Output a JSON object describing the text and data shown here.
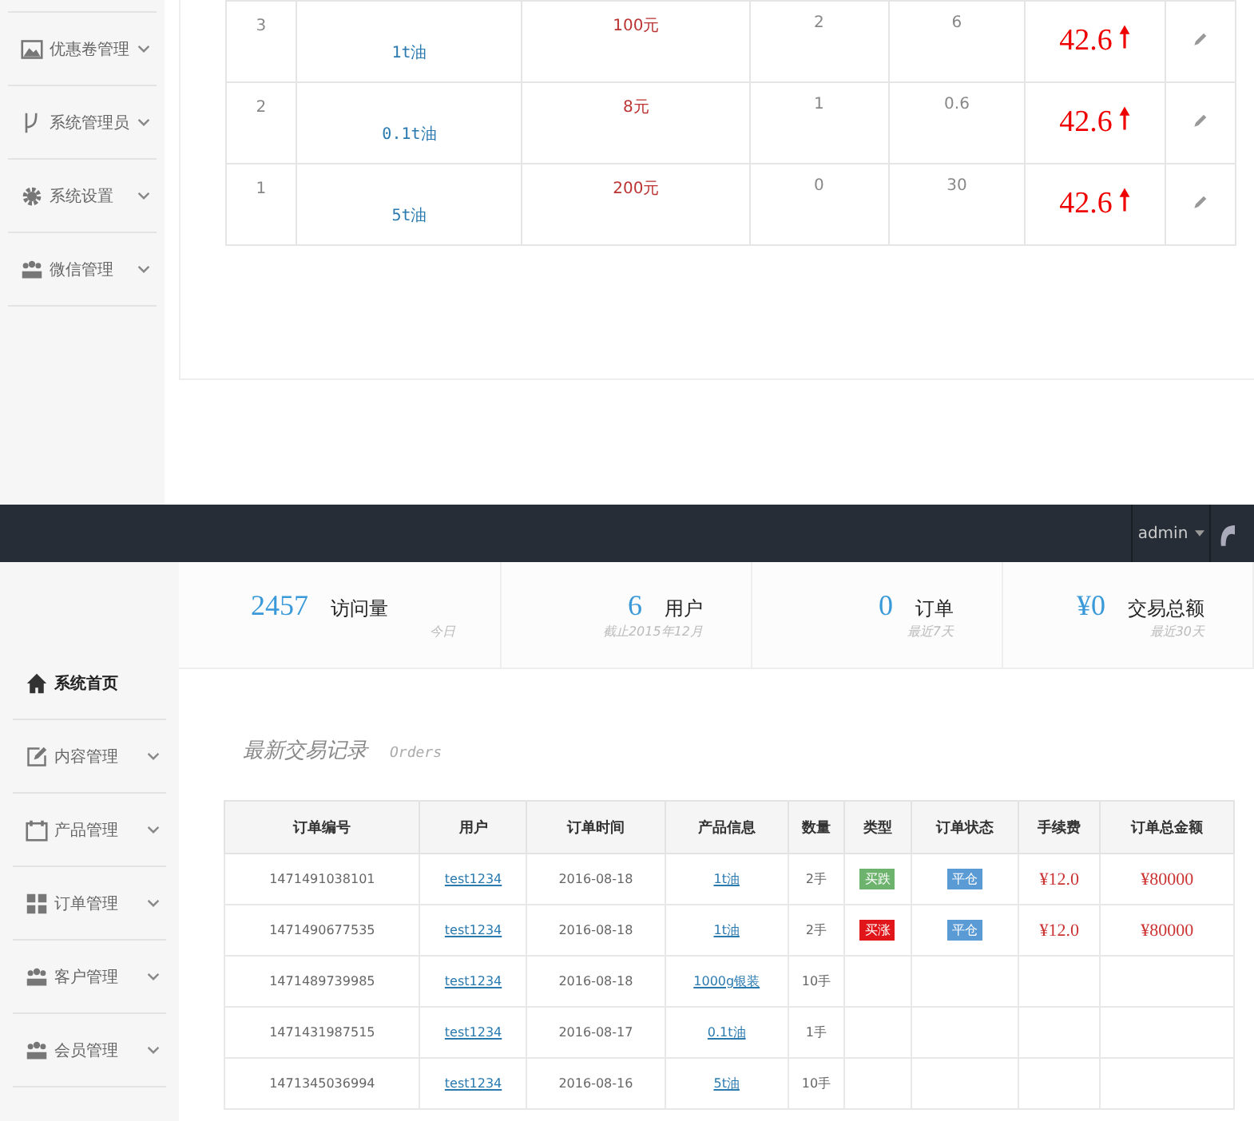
{
  "top_sidebar": {
    "items": [
      {
        "label": "优惠卷管理",
        "selected": false
      },
      {
        "label": "系统管理员",
        "selected": false
      },
      {
        "label": "系统设置",
        "selected": false
      },
      {
        "label": "微信管理",
        "selected": false
      }
    ]
  },
  "top_table": {
    "rows": [
      {
        "column_1": "3",
        "column_2": "1t油",
        "column_3": "100元",
        "column_4": "2",
        "column_5": "6",
        "column_6": "42.6"
      },
      {
        "column_1": "2",
        "column_2": "0.1t油",
        "column_3": "8元",
        "column_4": "1",
        "column_5": "0.6",
        "column_6": "42.6"
      },
      {
        "column_1": "1",
        "column_2": "5t油",
        "column_3": "200元",
        "column_4": "0",
        "column_5": "30",
        "column_6": "42.6"
      }
    ]
  },
  "navbar": {
    "user": "admin"
  },
  "stats": [
    {
      "value": "2457",
      "label": "访问量",
      "note": "今日"
    },
    {
      "value": "6",
      "label": "用户",
      "note": "截止2015年12月"
    },
    {
      "value": "0",
      "label": "订单",
      "note": "最近7天"
    },
    {
      "value": "¥0",
      "label": "交易总额",
      "note": "最近30天"
    }
  ],
  "sidebar": {
    "items": [
      {
        "label": "系统首页",
        "selected": true
      },
      {
        "label": "内容管理",
        "selected": false
      },
      {
        "label": "产品管理",
        "selected": false
      },
      {
        "label": "订单管理",
        "selected": false
      },
      {
        "label": "客户管理",
        "selected": false
      },
      {
        "label": "会员管理",
        "selected": false
      }
    ]
  },
  "section": {
    "title": "最新交易记录",
    "subtitle": "Orders"
  },
  "orders": {
    "columns": [
      "订单编号",
      "用户",
      "订单时间",
      "产品信息",
      "数量",
      "类型",
      "订单状态",
      "手续费",
      "订单总金额"
    ],
    "rows": [
      {
        "id": "1471491038101",
        "user": "test1234",
        "time": "2016-08-18",
        "product": "1t油",
        "qty": "2手",
        "type": {
          "label": "买跌",
          "color": "#6db36d"
        },
        "status": {
          "label": "平仓",
          "color": "#5b9bd5"
        },
        "fee": "¥12.0",
        "total": "¥80000"
      },
      {
        "id": "1471490677535",
        "user": "test1234",
        "time": "2016-08-18",
        "product": "1t油",
        "qty": "2手",
        "type": {
          "label": "买涨",
          "color": "#e0161b"
        },
        "status": {
          "label": "平仓",
          "color": "#5b9bd5"
        },
        "fee": "¥12.0",
        "total": "¥80000"
      },
      {
        "id": "1471489739985",
        "user": "test1234",
        "time": "2016-08-18",
        "product": "1000g银装",
        "qty": "10手"
      },
      {
        "id": "1471431987515",
        "user": "test1234",
        "time": "2016-08-17",
        "product": "0.1t油",
        "qty": "1手"
      },
      {
        "id": "1471345036994",
        "user": "test1234",
        "time": "2016-08-16",
        "product": "5t油",
        "qty": "10手"
      }
    ]
  }
}
